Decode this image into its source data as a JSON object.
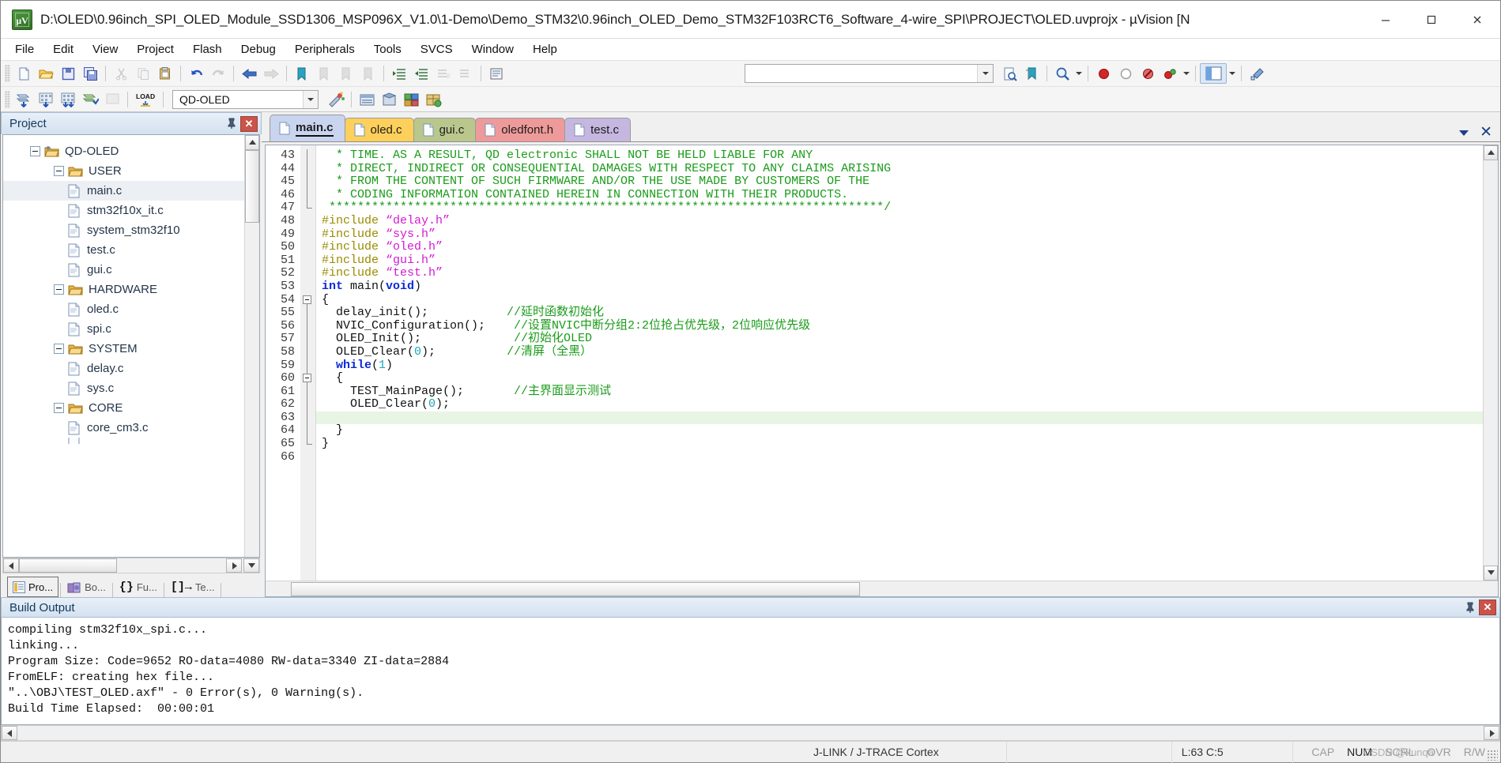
{
  "window": {
    "title": "D:\\OLED\\0.96inch_SPI_OLED_Module_SSD1306_MSP096X_V1.0\\1-Demo\\Demo_STM32\\0.96inch_OLED_Demo_STM32F103RCT6_Software_4-wire_SPI\\PROJECT\\OLED.uvprojx - µVision  [N",
    "app_icon": "uvision-logo-icon",
    "minimize": "minimize-button",
    "maximize": "maximize-button",
    "close": "close-button"
  },
  "menubar": {
    "items": [
      {
        "label": "File"
      },
      {
        "label": "Edit"
      },
      {
        "label": "View"
      },
      {
        "label": "Project"
      },
      {
        "label": "Flash"
      },
      {
        "label": "Debug"
      },
      {
        "label": "Peripherals"
      },
      {
        "label": "Tools"
      },
      {
        "label": "SVCS"
      },
      {
        "label": "Window"
      },
      {
        "label": "Help"
      }
    ]
  },
  "toolbar_main": {
    "buttons": [
      "new-file-icon",
      "open-file-icon",
      "save-icon",
      "save-all-icon",
      "cut-icon",
      "copy-icon",
      "paste-icon",
      "undo-icon",
      "redo-icon",
      "navigate-back-icon",
      "navigate-forward-icon",
      "bookmark-toggle-icon",
      "bookmark-prev-icon",
      "bookmark-next-icon",
      "bookmark-clear-icon",
      "indent-icon",
      "outdent-icon",
      "comment-icon",
      "uncomment-icon",
      "build-target-icon"
    ],
    "find_combo_value": "",
    "find_in_files_icon": "find-in-files-icon",
    "bookmark-list-icon": "bookmarks-icon",
    "zoom_icon": "magnifier-icon",
    "breakpoint_icon": "insert-breakpoint-icon",
    "disable_breakpoint_icon": "disable-breakpoint-icon",
    "kill_breakpoints_icon": "kill-all-breakpoints-icon",
    "disable_all_icon": "disable-all-breakpoints-icon",
    "window_layout_icon": "window-layout-icon",
    "configure_icon": "configuration-wizard-icon"
  },
  "toolbar_build": {
    "buttons": [
      "translate-icon",
      "build-icon",
      "rebuild-icon",
      "batch-build-icon",
      "stop-build-icon",
      "download-icon"
    ],
    "load_label": "LOAD",
    "target_value": "QD-OLED",
    "target_options": [
      "QD-OLED"
    ],
    "manage_project_items_icon": "manage-project-items-icon",
    "options_target_icon": "options-for-target-icon",
    "pack_installer_icon": "pack-installer-icon",
    "manage_runtime_icon": "manage-runtime-environment-icon",
    "select_software_icon": "select-software-packs-icon"
  },
  "project_panel": {
    "title": "Project",
    "pin_icon": "pin-icon",
    "close_icon": "close-icon",
    "tree": [
      {
        "label": "QD-OLED",
        "depth": 0,
        "type": "target",
        "expanded": true,
        "selected": false
      },
      {
        "label": "USER",
        "depth": 1,
        "type": "group",
        "expanded": true,
        "selected": false
      },
      {
        "label": "main.c",
        "depth": 2,
        "type": "file",
        "expanded": false,
        "selected": true
      },
      {
        "label": "stm32f10x_it.c",
        "depth": 2,
        "type": "file",
        "expanded": false,
        "selected": false
      },
      {
        "label": "system_stm32f10",
        "depth": 2,
        "type": "file",
        "expanded": false,
        "selected": false
      },
      {
        "label": "test.c",
        "depth": 2,
        "type": "file",
        "expanded": false,
        "selected": false
      },
      {
        "label": "gui.c",
        "depth": 2,
        "type": "file",
        "expanded": false,
        "selected": false
      },
      {
        "label": "HARDWARE",
        "depth": 1,
        "type": "group",
        "expanded": true,
        "selected": false
      },
      {
        "label": "oled.c",
        "depth": 2,
        "type": "file",
        "expanded": false,
        "selected": false
      },
      {
        "label": "spi.c",
        "depth": 2,
        "type": "file",
        "expanded": false,
        "selected": false
      },
      {
        "label": "SYSTEM",
        "depth": 1,
        "type": "group",
        "expanded": true,
        "selected": false
      },
      {
        "label": "delay.c",
        "depth": 2,
        "type": "file",
        "expanded": false,
        "selected": false
      },
      {
        "label": "sys.c",
        "depth": 2,
        "type": "file",
        "expanded": false,
        "selected": false
      },
      {
        "label": "CORE",
        "depth": 1,
        "type": "group",
        "expanded": true,
        "selected": false
      },
      {
        "label": "core_cm3.c",
        "depth": 2,
        "type": "file",
        "expanded": false,
        "selected": false
      }
    ],
    "tabs": [
      {
        "label": "Pro...",
        "icon": "project-icon",
        "active": true
      },
      {
        "label": "Bo...",
        "icon": "books-icon",
        "active": false
      },
      {
        "label": "Fu...",
        "icon": "functions-icon",
        "active": false
      },
      {
        "label": "Te...",
        "icon": "templates-icon",
        "active": false
      }
    ]
  },
  "editor": {
    "tabs": [
      {
        "label": "main.c",
        "color": "#c9d4ef",
        "active": true
      },
      {
        "label": "oled.c",
        "color": "#fcd05a",
        "active": false
      },
      {
        "label": "gui.c",
        "color": "#b9c78d",
        "active": false
      },
      {
        "label": "oledfont.h",
        "color": "#ef9a9a",
        "active": false
      },
      {
        "label": "test.c",
        "color": "#c6b7e0",
        "active": false
      }
    ],
    "tab_menu_icon": "tab-list-dropdown-icon",
    "tab_close_icon": "close-document-icon",
    "first_line": 43,
    "highlight_line": 63,
    "lines": [
      {
        "n": 43,
        "fold": "",
        "tokens": [
          {
            "t": "  * TIME. AS A RESULT, QD electronic SHALL NOT BE HELD LIABLE FOR ANY",
            "c": "cm"
          }
        ]
      },
      {
        "n": 44,
        "fold": "",
        "tokens": [
          {
            "t": "  * DIRECT, INDIRECT OR CONSEQUENTIAL DAMAGES WITH RESPECT TO ANY CLAIMS ARISING",
            "c": "cm"
          }
        ]
      },
      {
        "n": 45,
        "fold": "",
        "tokens": [
          {
            "t": "  * FROM THE CONTENT OF SUCH FIRMWARE AND/OR THE USE MADE BY CUSTOMERS OF THE",
            "c": "cm"
          }
        ]
      },
      {
        "n": 46,
        "fold": "",
        "tokens": [
          {
            "t": "  * CODING INFORMATION CONTAINED HEREIN IN CONNECTION WITH THEIR PRODUCTS.",
            "c": "cm"
          }
        ]
      },
      {
        "n": 47,
        "fold": "end",
        "tokens": [
          {
            "t": " ******************************************************************************/",
            "c": "cm"
          }
        ]
      },
      {
        "n": 48,
        "fold": "",
        "tokens": [
          {
            "t": "#include ",
            "c": "pp"
          },
          {
            "t": "“delay.h”",
            "c": "str"
          }
        ]
      },
      {
        "n": 49,
        "fold": "",
        "tokens": [
          {
            "t": "#include ",
            "c": "pp"
          },
          {
            "t": "“sys.h”",
            "c": "str"
          }
        ]
      },
      {
        "n": 50,
        "fold": "",
        "tokens": [
          {
            "t": "#include ",
            "c": "pp"
          },
          {
            "t": "“oled.h”",
            "c": "str"
          }
        ]
      },
      {
        "n": 51,
        "fold": "",
        "tokens": [
          {
            "t": "#include ",
            "c": "pp"
          },
          {
            "t": "“gui.h”",
            "c": "str"
          }
        ]
      },
      {
        "n": 52,
        "fold": "",
        "tokens": [
          {
            "t": "#include ",
            "c": "pp"
          },
          {
            "t": "“test.h”",
            "c": "str"
          }
        ]
      },
      {
        "n": 53,
        "fold": "",
        "tokens": [
          {
            "t": "int ",
            "c": "kw"
          },
          {
            "t": "main(",
            "c": ""
          },
          {
            "t": "void",
            "c": "kw"
          },
          {
            "t": ")",
            "c": ""
          }
        ]
      },
      {
        "n": 54,
        "fold": "open",
        "tokens": [
          {
            "t": "{",
            "c": ""
          }
        ]
      },
      {
        "n": 55,
        "fold": "bar",
        "tokens": [
          {
            "t": "  delay_init();           ",
            "c": ""
          },
          {
            "t": "//延时函数初始化",
            "c": "cm"
          }
        ]
      },
      {
        "n": 56,
        "fold": "bar",
        "tokens": [
          {
            "t": "  NVIC_Configuration();    ",
            "c": ""
          },
          {
            "t": "//设置NVIC中断分组2:2位抢占优先级，2位响应优先级",
            "c": "cm"
          }
        ]
      },
      {
        "n": 57,
        "fold": "bar",
        "tokens": [
          {
            "t": "  OLED_Init();             ",
            "c": ""
          },
          {
            "t": "//初始化OLED",
            "c": "cm"
          }
        ]
      },
      {
        "n": 58,
        "fold": "bar",
        "tokens": [
          {
            "t": "  OLED_Clear(",
            "c": ""
          },
          {
            "t": "0",
            "c": "num"
          },
          {
            "t": ");          ",
            "c": ""
          },
          {
            "t": "//清屏（全黑）",
            "c": "cm"
          }
        ]
      },
      {
        "n": 59,
        "fold": "bar",
        "tokens": [
          {
            "t": "  while",
            "c": "kw"
          },
          {
            "t": "(",
            "c": ""
          },
          {
            "t": "1",
            "c": "num"
          },
          {
            "t": ")",
            "c": ""
          }
        ]
      },
      {
        "n": 60,
        "fold": "open2",
        "tokens": [
          {
            "t": "  {",
            "c": ""
          }
        ]
      },
      {
        "n": 61,
        "fold": "bar2",
        "tokens": [
          {
            "t": "    TEST_MainPage();       ",
            "c": ""
          },
          {
            "t": "//主界面显示测试",
            "c": "cm"
          }
        ]
      },
      {
        "n": 62,
        "fold": "bar2",
        "tokens": [
          {
            "t": "    OLED_Clear(",
            "c": ""
          },
          {
            "t": "0",
            "c": "num"
          },
          {
            "t": ");",
            "c": ""
          }
        ]
      },
      {
        "n": 63,
        "fold": "bar2",
        "tokens": [
          {
            "t": "",
            "c": ""
          }
        ]
      },
      {
        "n": 64,
        "fold": "end2",
        "tokens": [
          {
            "t": "  }",
            "c": ""
          }
        ]
      },
      {
        "n": 65,
        "fold": "endm",
        "tokens": [
          {
            "t": "}",
            "c": ""
          }
        ]
      },
      {
        "n": 66,
        "fold": "",
        "tokens": [
          {
            "t": "",
            "c": ""
          }
        ]
      }
    ]
  },
  "build_output": {
    "title": "Build Output",
    "pin_icon": "pin-icon",
    "close_icon": "close-icon",
    "lines": [
      "compiling stm32f10x_spi.c...",
      "linking...",
      "Program Size: Code=9652 RO-data=4080 RW-data=3340 ZI-data=2884",
      "FromELF: creating hex file...",
      "\"..\\OBJ\\TEST_OLED.axf\" - 0 Error(s), 0 Warning(s).",
      "Build Time Elapsed:  00:00:01"
    ]
  },
  "statusbar": {
    "debugger": "J-LINK / J-TRACE Cortex",
    "cursor": "L:63 C:5",
    "flags": [
      {
        "label": "CAP",
        "on": false
      },
      {
        "label": "NUM",
        "on": true
      },
      {
        "label": "SCRL",
        "on": false
      },
      {
        "label": "OVR",
        "on": false
      },
      {
        "label": "R/W",
        "on": false
      }
    ],
    "watermark": "CSDN @kunqa"
  },
  "colors": {
    "panel_header": "#d3e1f0",
    "comment": "#1a9c1a",
    "preprocessor": "#9b8b00",
    "string": "#d21ad2",
    "keyword": "#0b2ad6",
    "number": "#1aa8b8",
    "highlight_line": "#e8f5e4",
    "close_red": "#c9544a"
  }
}
